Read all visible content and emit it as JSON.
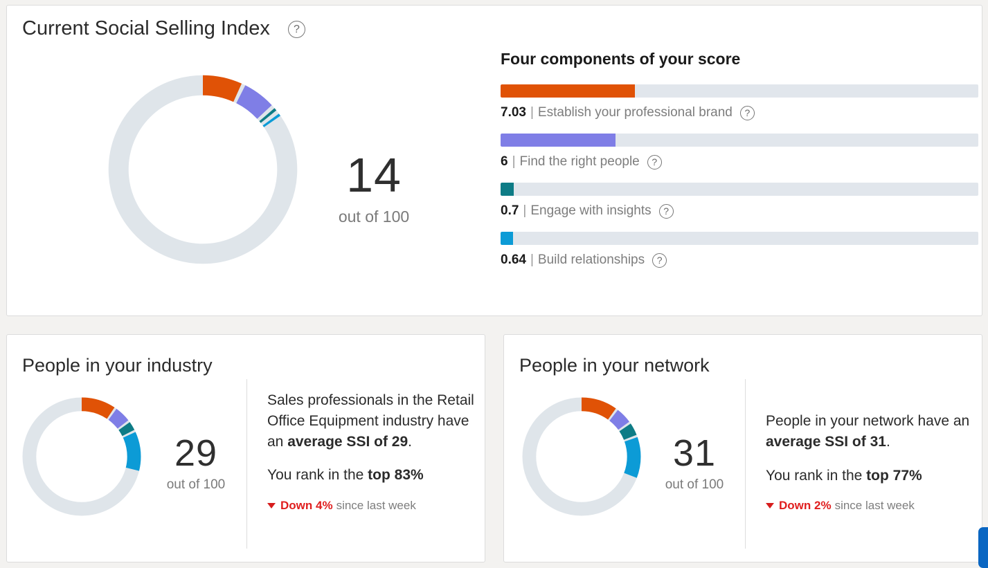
{
  "ssi_card": {
    "title": "Current Social Selling Index",
    "help_icon": "question-circle-icon",
    "score": "14",
    "out_of": "out of 100"
  },
  "components": {
    "heading": "Four components of your score",
    "max_per_component": 25,
    "items": [
      {
        "score": "7.03",
        "separator": "|",
        "name": "Establish your professional brand",
        "color": "#e05206",
        "value": 7.03,
        "help_icon": "question-circle-icon"
      },
      {
        "score": "6",
        "separator": "|",
        "name": "Find the right people",
        "color": "#7f7ee6",
        "value": 6.0,
        "help_icon": "question-circle-icon"
      },
      {
        "score": "0.7",
        "separator": "|",
        "name": "Engage with insights",
        "color": "#0e7c86",
        "value": 0.7,
        "help_icon": "question-circle-icon"
      },
      {
        "score": "0.64",
        "separator": "|",
        "name": "Build relationships",
        "color": "#0c9bd6",
        "value": 0.64,
        "help_icon": "question-circle-icon"
      }
    ]
  },
  "industry_card": {
    "title": "People in your industry",
    "score": "29",
    "out_of": "out of 100",
    "body_plain_1": "Sales professionals in the Retail Office Equipment industry have an ",
    "body_bold_1": "average SSI of 29",
    "body_plain_2": ".",
    "rank_plain": "You rank in the ",
    "rank_bold": "top 83%",
    "trend_caret": "caret-down-icon",
    "trend_strong": "Down 4%",
    "trend_rest": "since last week"
  },
  "network_card": {
    "title": "People in your network",
    "score": "31",
    "out_of": "out of 100",
    "body_plain_1": "People in your network have an ",
    "body_bold_1": "average SSI of 31",
    "body_plain_2": ".",
    "rank_plain": "You rank in the ",
    "rank_bold": "top 77%",
    "trend_caret": "caret-down-icon",
    "trend_strong": "Down 2%",
    "trend_rest": "since last week"
  },
  "chart_data": [
    {
      "type": "pie",
      "title": "Current Social Selling Index",
      "total_label": "14",
      "max": 100,
      "categories": [
        "Establish your professional brand",
        "Find the right people",
        "Engage with insights",
        "Build relationships",
        "Remaining"
      ],
      "values": [
        7.03,
        6,
        0.7,
        0.64,
        85.63
      ],
      "colors": [
        "#e05206",
        "#7f7ee6",
        "#0e7c86",
        "#0c9bd6",
        "#dfe5ea"
      ],
      "legend": "right"
    },
    {
      "type": "bar",
      "title": "Four components of your score",
      "categories": [
        "Establish your professional brand",
        "Find the right people",
        "Engage with insights",
        "Build relationships"
      ],
      "values": [
        7.03,
        6,
        0.7,
        0.64
      ],
      "colors": [
        "#e05206",
        "#7f7ee6",
        "#0e7c86",
        "#0c9bd6"
      ],
      "xlabel": "",
      "ylabel": "",
      "xlim": [
        0,
        25
      ],
      "grid": false
    },
    {
      "type": "pie",
      "title": "People in your industry",
      "total_label": "29",
      "max": 100,
      "categories": [
        "Establish your professional brand",
        "Find the right people",
        "Engage with insights",
        "Build relationships",
        "Remaining"
      ],
      "values": [
        10,
        5,
        3,
        11,
        71
      ],
      "colors": [
        "#e05206",
        "#7f7ee6",
        "#0e7c86",
        "#0c9bd6",
        "#dfe5ea"
      ]
    },
    {
      "type": "pie",
      "title": "People in your network",
      "total_label": "31",
      "max": 100,
      "categories": [
        "Establish your professional brand",
        "Find the right people",
        "Engage with insights",
        "Build relationships",
        "Remaining"
      ],
      "values": [
        10.5,
        5,
        4,
        11.5,
        69
      ],
      "colors": [
        "#e05206",
        "#7f7ee6",
        "#0e7c86",
        "#0c9bd6",
        "#dfe5ea"
      ]
    }
  ]
}
